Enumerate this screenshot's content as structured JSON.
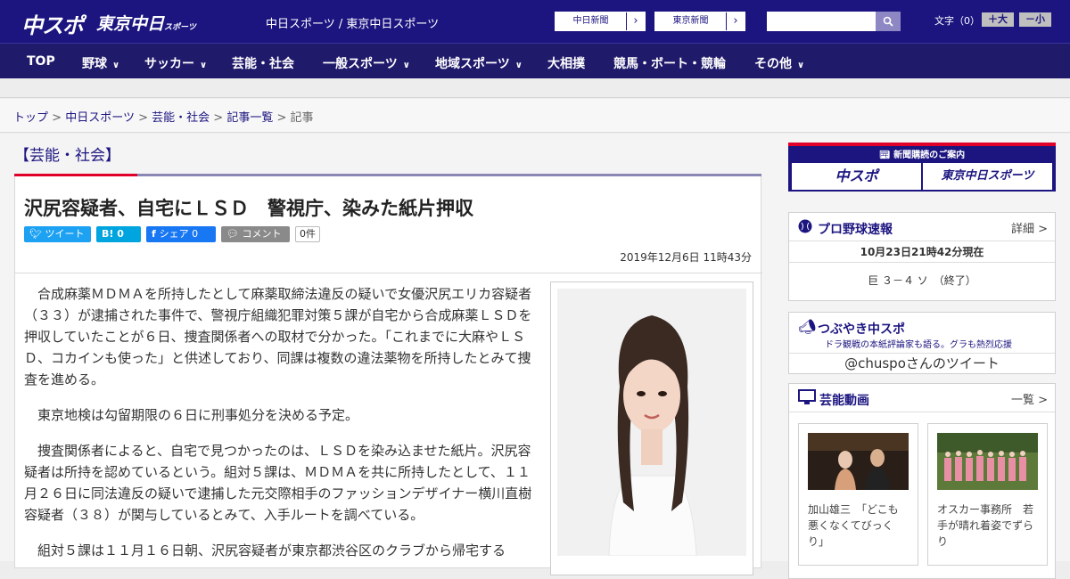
{
  "header": {
    "logo_chuspo": "中スポ",
    "logo_tokyo": "東京中日",
    "logo_tokyo_sub": "スポーツ",
    "site_name": "中日スポーツ / 東京中日スポーツ",
    "link_chunichi": "中日新聞",
    "link_tokyo": "東京新聞",
    "search_placeholder": "",
    "font_label": "文字（0）",
    "font_larger": "＋大",
    "font_smaller": "－小"
  },
  "nav": {
    "items": [
      "TOP",
      "野球",
      "サッカー",
      "芸能・社会",
      "一般スポーツ",
      "地域スポーツ",
      "大相撲",
      "競馬・ボート・競輪",
      "その他"
    ]
  },
  "breadcrumb": {
    "items": [
      "トップ",
      "中日スポーツ",
      "芸能・社会",
      "記事一覧"
    ],
    "separator": ">",
    "current": "記事"
  },
  "article": {
    "category": "【芸能・社会】",
    "headline": "沢尻容疑者、自宅にＬＳＤ　警視庁、染みた紙片押収",
    "share_twitter": "ツイート",
    "share_hatena": "B! 0",
    "share_facebook": "シェア 0",
    "share_comment": "コメント",
    "comment_count": "0件",
    "date": "2019年12月6日 11時43分",
    "paragraphs": [
      "合成麻薬ＭＤＭＡを所持したとして麻薬取締法違反の疑いで女優沢尻エリカ容疑者（３３）が逮捕された事件で、警視庁組織犯罪対策５課が自宅から合成麻薬ＬＳＤを押収していたことが６日、捜査関係者への取材で分かった。「これまでに大麻やＬＳＤ、コカインも使った」と供述しており、同課は複数の違法薬物を所持したとみて捜査を進める。",
      "東京地検は勾留期限の６日に刑事処分を決める予定。",
      "捜査関係者によると、自宅で見つかったのは、ＬＳＤを染み込ませた紙片。沢尻容疑者は所持を認めているという。組対５課は、ＭＤＭＡを共に所持したとして、１１月２６日に同法違反の疑いで逮捕した元交際相手のファッションデザイナー横川直樹容疑者（３８）が関与しているとみて、入手ルートを調べている。",
      "組対５課は１１月１６日朝、沢尻容疑者が東京都渋谷区のクラブから帰宅する"
    ]
  },
  "sidebar": {
    "subscribe_title": "新聞購読のご案内",
    "subscribe_chuspo": "中スポ",
    "subscribe_tokyo": "東京中日スポーツ",
    "baseball": {
      "title": "プロ野球速報",
      "more": "詳細 >",
      "time": "10月23日21時42分現在",
      "score": "巨 ３－４ ソ　（終了）"
    },
    "tweets": {
      "title": "つぶやき中スポ",
      "subtitle": "ドラ観戦の本紙評論家も語る。グラも熱烈応援",
      "link": "@chuspoさんのツイート"
    },
    "videos": {
      "title": "芸能動画",
      "more": "一覧 >",
      "items": [
        {
          "caption": "加山雄三　「どこも悪くなくてびっくり」"
        },
        {
          "caption": "オスカー事務所　若手が晴れ着姿でずらり"
        }
      ]
    }
  }
}
